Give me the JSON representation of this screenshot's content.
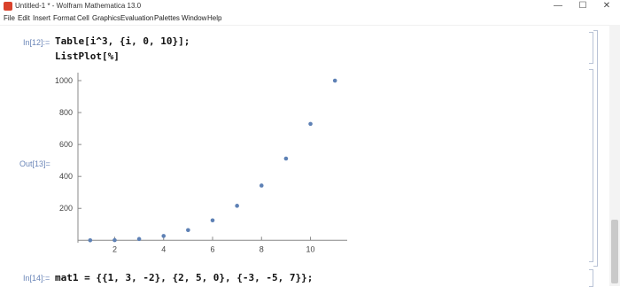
{
  "window": {
    "title": "Untitled-1 * - Wolfram Mathematica 13.0",
    "controls": {
      "minimize": "—",
      "maximize": "☐",
      "close": "✕"
    }
  },
  "menu": [
    "File",
    "Edit",
    "Insert",
    "Format",
    "Cell",
    "Graphics",
    "Evaluation",
    "Palettes",
    "Window",
    "Help"
  ],
  "cells": {
    "in12_label": "In[12]:=",
    "in12_line1": "Table[i^3, {i, 0, 10}];",
    "in12_line2": "ListPlot[%]",
    "out13_label": "Out[13]=",
    "in14_label": "In[14]:=",
    "in14_line1": "mat1 = {{1, 3, -2}, {2, 5, 0}, {-3, -5, 7}};"
  },
  "colors": {
    "point": "#5e81b5",
    "label": "#6b86b8",
    "axis": "#888888"
  },
  "chart_data": {
    "type": "scatter",
    "x": [
      1,
      2,
      3,
      4,
      5,
      6,
      7,
      8,
      9,
      10,
      11
    ],
    "y": [
      0,
      1,
      8,
      27,
      64,
      125,
      216,
      343,
      512,
      729,
      1000
    ],
    "xticks": [
      2,
      4,
      6,
      8,
      10
    ],
    "yticks": [
      200,
      400,
      600,
      800,
      1000
    ],
    "xlim": [
      0.5,
      11.5
    ],
    "ylim": [
      -15,
      1050
    ],
    "grid": false
  }
}
